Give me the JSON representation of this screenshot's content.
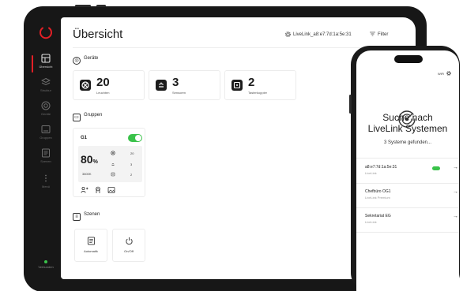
{
  "tablet": {
    "sidebar": {
      "items": [
        {
          "label": "Übersicht",
          "icon": "layout-icon",
          "active": true
        },
        {
          "label": "Struktur",
          "icon": "stack-icon",
          "active": false
        },
        {
          "label": "Geräte",
          "icon": "device-icon",
          "active": false
        },
        {
          "label": "Gruppen",
          "icon": "group-icon",
          "active": false
        },
        {
          "label": "Szenen",
          "icon": "scene-icon",
          "active": false
        },
        {
          "label": "Menü",
          "icon": "menu-icon",
          "active": false
        }
      ],
      "connection_label": "Verbunden"
    },
    "header": {
      "title": "Übersicht",
      "livelink_label": "LiveLink_a8:e7:7d:1a:5e:31",
      "filter_label": "Filter"
    },
    "devices": {
      "title": "Geräte",
      "cards": [
        {
          "count": "20",
          "label": "Leuchten",
          "icon": "lamp-icon"
        },
        {
          "count": "3",
          "label": "Sensoren",
          "icon": "sensor-icon"
        },
        {
          "count": "2",
          "label": "Tasterkoppler",
          "icon": "button-coupler-icon"
        }
      ]
    },
    "groups": {
      "title": "Gruppen",
      "card": {
        "name": "G1",
        "toggle_on": true,
        "brightness": "80",
        "brightness_unit": "%",
        "color_temp": "3800K",
        "rows": [
          {
            "icon": "lamp-icon",
            "value": "20"
          },
          {
            "icon": "sensor-icon",
            "value": "3"
          },
          {
            "icon": "button-coupler-icon",
            "value": "2"
          }
        ]
      }
    },
    "scenes": {
      "title": "Szenen",
      "cards": [
        {
          "label": "Automatik",
          "icon": "automation-icon"
        },
        {
          "label": "On/Off",
          "icon": "power-icon"
        }
      ]
    }
  },
  "phone": {
    "status_text": "WiFi",
    "title_line1": "Suche nach",
    "title_line2": "LiveLink Systemen",
    "found_text": "3 Systeme gefunden...",
    "systems": [
      {
        "name": "a8:e7:7d:1a:5e:31",
        "sub": "LiveLink",
        "connected": true
      },
      {
        "name": "Chefbüro OG1",
        "sub": "LiveLink Premium",
        "connected": false
      },
      {
        "name": "Sekretariat EG",
        "sub": "LiveLink",
        "connected": false
      }
    ]
  },
  "colors": {
    "accent_red": "#e21f26",
    "toggle_green": "#3ac24a",
    "device_dark": "#171717"
  }
}
